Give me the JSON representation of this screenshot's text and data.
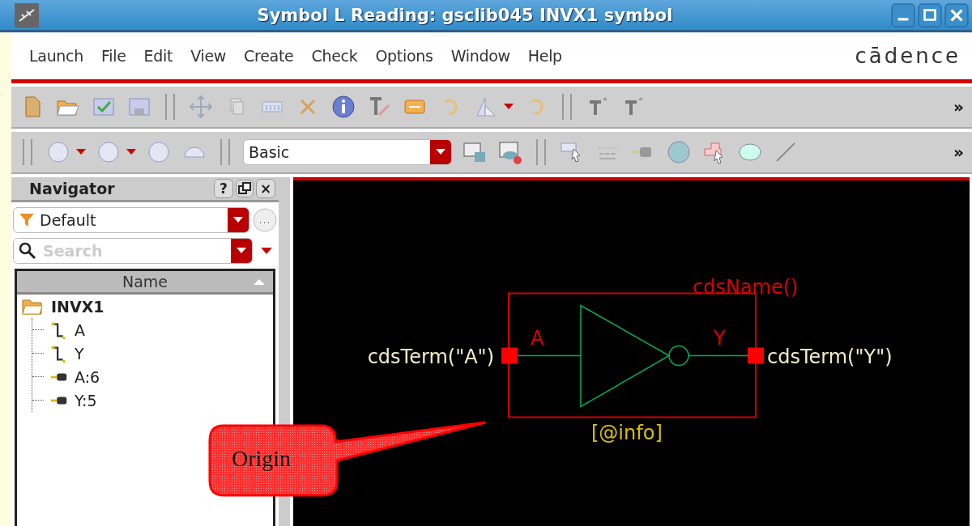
{
  "window": {
    "title": "Symbol L Reading: gsclib045 INVX1 symbol"
  },
  "menu": [
    {
      "label": "Launch"
    },
    {
      "label": "File"
    },
    {
      "label": "Edit"
    },
    {
      "label": "View"
    },
    {
      "label": "Create"
    },
    {
      "label": "Check"
    },
    {
      "label": "Options"
    },
    {
      "label": "Window"
    },
    {
      "label": "Help"
    }
  ],
  "logo": "cādence",
  "toolbar": {
    "overflow_1": "»",
    "overflow_2": "»",
    "view_combo": {
      "value": "Basic"
    }
  },
  "navigator": {
    "title": "Navigator",
    "buttons": [
      "?",
      "×"
    ],
    "filter": {
      "value": "Default"
    },
    "search": {
      "placeholder": "Search"
    },
    "column": "Name",
    "tree": [
      {
        "label": "INVX1",
        "kind": "cell",
        "children": [
          {
            "label": "A",
            "kind": "pin"
          },
          {
            "label": "Y",
            "kind": "pin"
          },
          {
            "label": "A:6",
            "kind": "terminal"
          },
          {
            "label": "Y:5",
            "kind": "terminal"
          }
        ]
      }
    ]
  },
  "canvas": {
    "instance_name": "cdsName()",
    "term_left": "cdsTerm(\"A\")",
    "pin_left": "A",
    "pin_right": "Y",
    "term_right": "cdsTerm(\"Y\")",
    "info": "[@info]"
  },
  "callout": {
    "text": "Origin"
  }
}
